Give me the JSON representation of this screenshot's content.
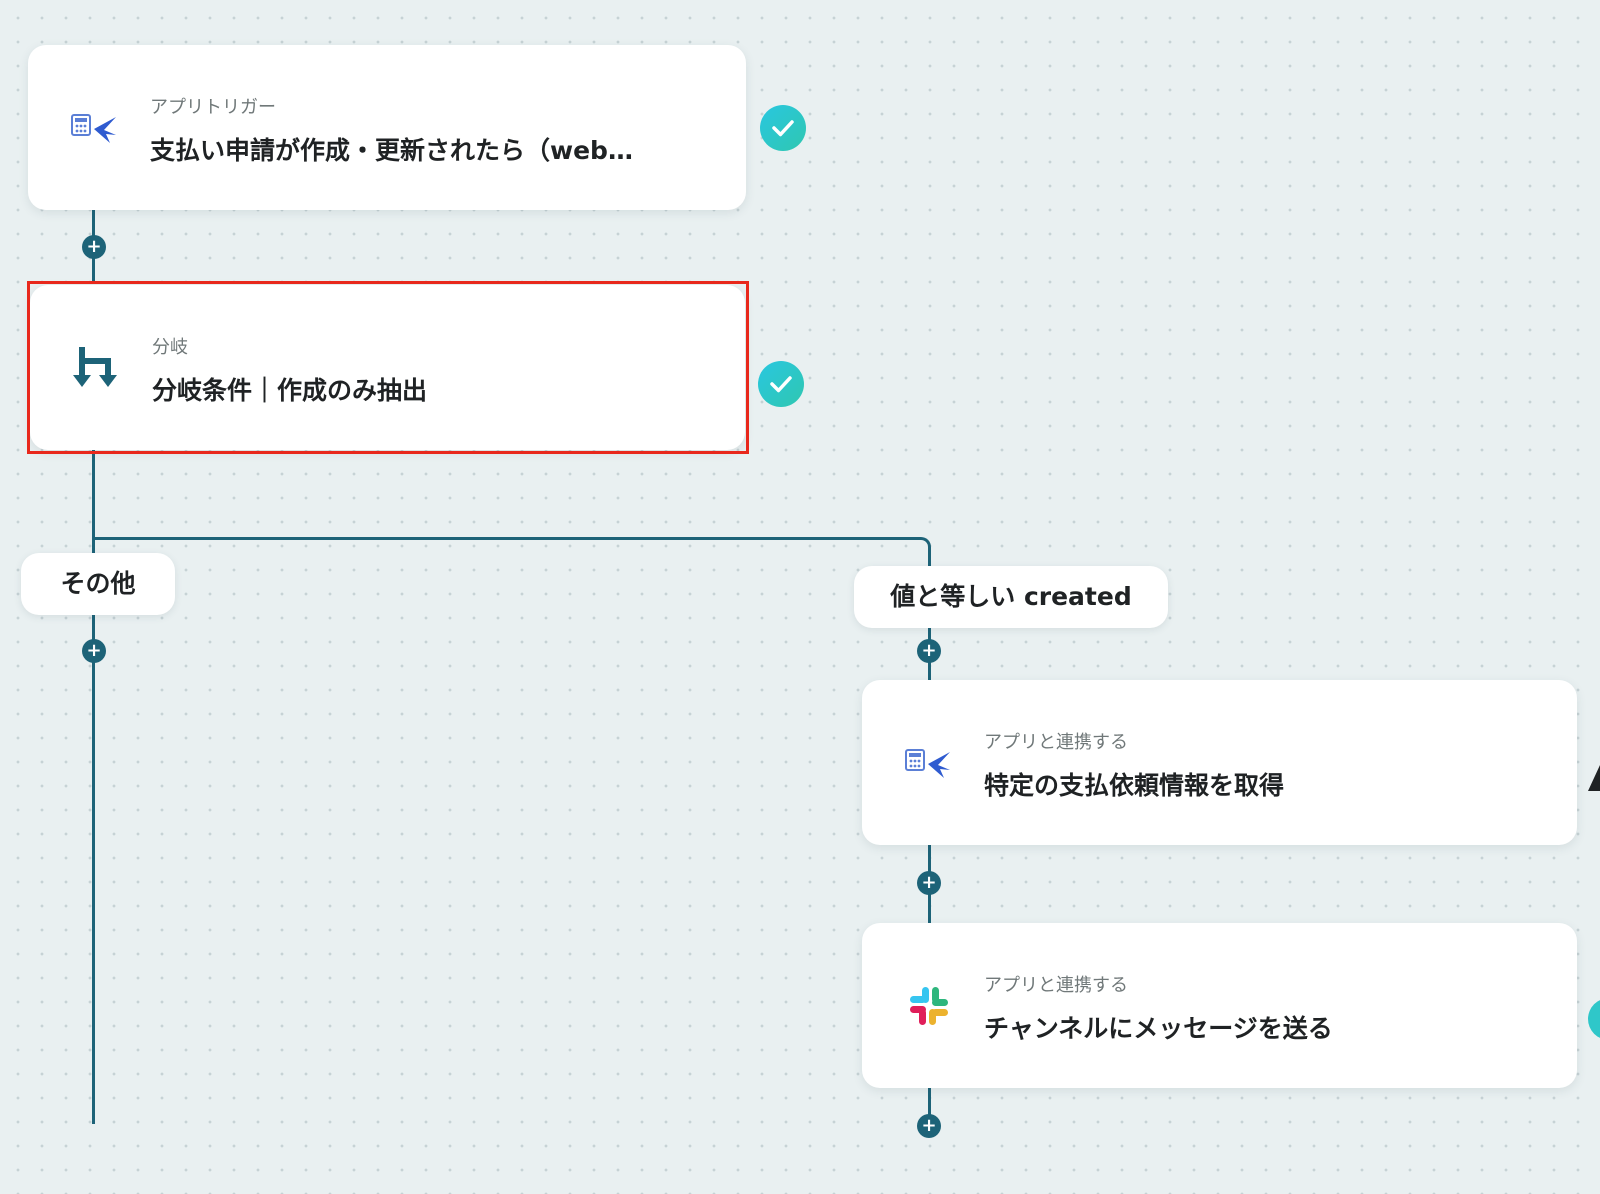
{
  "nodes": {
    "trigger": {
      "label": "アプリトリガー",
      "title": "支払い申請が作成・更新されたら（web…",
      "icon": "payment-app-icon"
    },
    "branch": {
      "label": "分岐",
      "title": "分岐条件｜作成のみ抽出",
      "icon": "branch-icon"
    },
    "get_info": {
      "label": "アプリと連携する",
      "title": "特定の支払依頼情報を取得",
      "icon": "payment-app-icon"
    },
    "send_message": {
      "label": "アプリと連携する",
      "title": "チャンネルにメッセージを送る",
      "icon": "slack-icon"
    }
  },
  "branches": {
    "other": "その他",
    "equals": "値と等しい created"
  },
  "colors": {
    "connector": "#1d6378",
    "check": "#2fc7c9",
    "highlight": "#e8281c"
  }
}
